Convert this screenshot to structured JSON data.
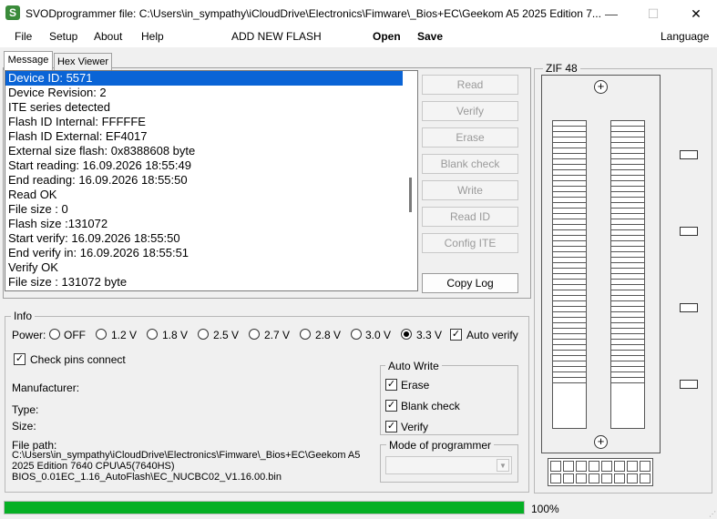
{
  "window": {
    "title": "SVODprogrammer file: C:\\Users\\in_sympathy\\iCloudDrive\\Electronics\\Fimware\\_Bios+EC\\Geekom A5 2025 Edition 7...",
    "icon_letter": "S",
    "minimize": "—",
    "maximize": "☐",
    "close": "✕"
  },
  "menu": {
    "file": "File",
    "setup": "Setup",
    "about": "About",
    "help": "Help",
    "add_new_flash": "ADD NEW FLASH",
    "open": "Open",
    "save": "Save",
    "language": "Language"
  },
  "tabs": [
    "Message",
    "Hex Viewer"
  ],
  "log": [
    "Device ID: 5571",
    "Device Revision: 2",
    "ITE series detected",
    "Flash ID Internal: FFFFFE",
    "Flash ID External: EF4017",
    "External size flash: 0x8388608 byte",
    "Start reading: 16.09.2026 18:55:49",
    "End reading: 16.09.2026 18:55:50",
    "Read OK",
    "File size : 0",
    "Flash size :131072",
    "Start verify: 16.09.2026 18:55:50",
    "End verify in: 16.09.2026 18:55:51",
    "Verify OK",
    "File size : 131072 byte"
  ],
  "buttons": {
    "read": "Read",
    "verify": "Verify",
    "erase": "Erase",
    "blank_check": "Blank check",
    "write": "Write",
    "read_id": "Read ID",
    "config_ite": "Config ITE",
    "copy_log": "Copy Log"
  },
  "info": {
    "group_label": "Info",
    "power_label": "Power:",
    "power_options": [
      "OFF",
      "1.2 V",
      "1.8 V",
      "2.5 V",
      "2.7 V",
      "2.8 V",
      "3.0 V",
      "3.3 V"
    ],
    "power_selected": "3.3 V",
    "auto_verify": "Auto verify",
    "check_pins": "Check pins connect",
    "manufacturer": "Manufacturer:",
    "type": "Type:",
    "size": "Size:",
    "file_path_label": "File path:",
    "file_path_line1": "C:\\Users\\in_sympathy\\iCloudDrive\\Electronics\\Fimware\\_Bios+EC\\Geekom A5",
    "file_path_line2": "2025 Edition 7640 CPU\\A5(7640HS)",
    "file_path_line3": "BIOS_0.01EC_1.16_AutoFlash\\EC_NUCBC02_V1.16.00.bin"
  },
  "auto_write": {
    "label": "Auto Write",
    "erase": "Erase",
    "blank_check": "Blank check",
    "verify": "Verify"
  },
  "mode": {
    "label": "Mode of programmer",
    "value": ""
  },
  "zif": {
    "label": "ZIF 48"
  },
  "progress": {
    "value": 1.0,
    "text": "100%"
  },
  "colors": {
    "selection": "#0a64d6",
    "progress": "#06b025",
    "icon": "#3a8b3a"
  }
}
